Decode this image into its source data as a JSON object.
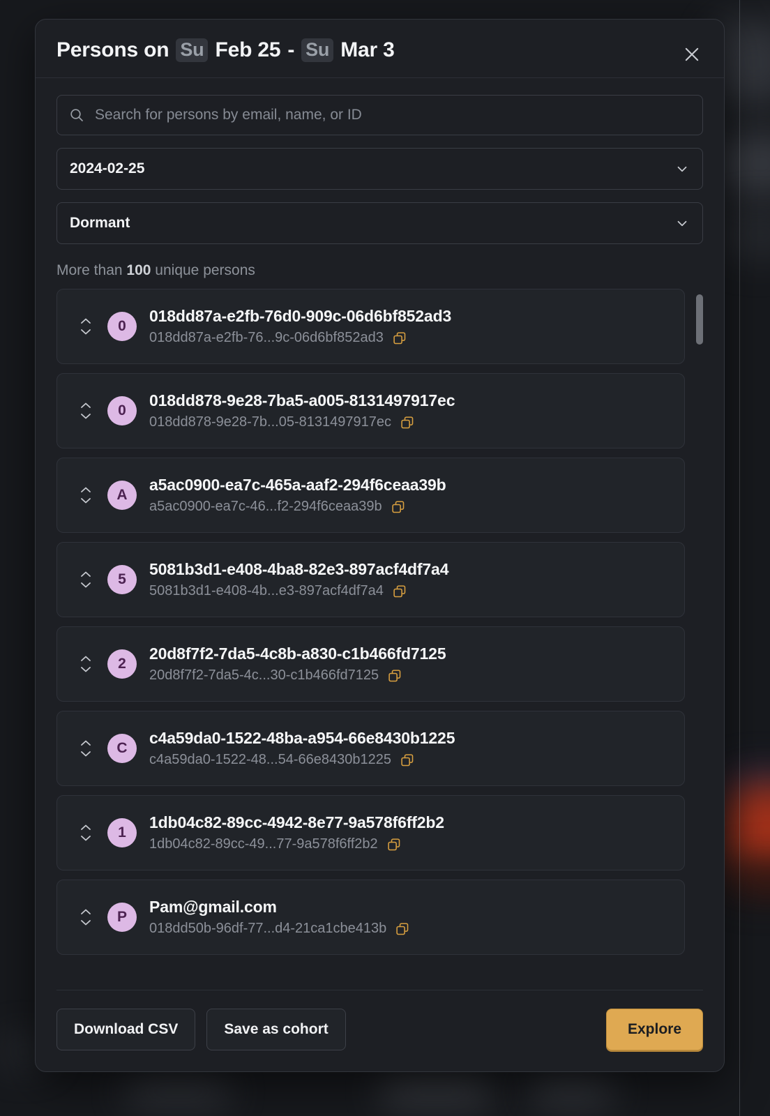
{
  "header": {
    "title_prefix": "Persons on",
    "start_day_badge": "Su",
    "start_date": "Feb 25",
    "separator": "-",
    "end_day_badge": "Su",
    "end_date": "Mar 3",
    "close_icon": "close-icon"
  },
  "search": {
    "placeholder": "Search for persons by email, name, or ID",
    "value": "",
    "icon": "search-icon"
  },
  "filters": {
    "date_select": {
      "value": "2024-02-25",
      "icon": "chevron-down-icon"
    },
    "status_select": {
      "value": "Dormant",
      "icon": "chevron-down-icon"
    }
  },
  "count": {
    "prefix": "More than",
    "number": "100",
    "suffix": "unique persons"
  },
  "persons": [
    {
      "avatar_initial": "0",
      "name": "018dd87a-e2fb-76d0-909c-06d6bf852ad3",
      "id_truncated": "018dd87a-e2fb-76...9c-06d6bf852ad3"
    },
    {
      "avatar_initial": "0",
      "name": "018dd878-9e28-7ba5-a005-8131497917ec",
      "id_truncated": "018dd878-9e28-7b...05-8131497917ec"
    },
    {
      "avatar_initial": "A",
      "name": "a5ac0900-ea7c-465a-aaf2-294f6ceaa39b",
      "id_truncated": "a5ac0900-ea7c-46...f2-294f6ceaa39b"
    },
    {
      "avatar_initial": "5",
      "name": "5081b3d1-e408-4ba8-82e3-897acf4df7a4",
      "id_truncated": "5081b3d1-e408-4b...e3-897acf4df7a4"
    },
    {
      "avatar_initial": "2",
      "name": "20d8f7f2-7da5-4c8b-a830-c1b466fd7125",
      "id_truncated": "20d8f7f2-7da5-4c...30-c1b466fd7125"
    },
    {
      "avatar_initial": "C",
      "name": "c4a59da0-1522-48ba-a954-66e8430b1225",
      "id_truncated": "c4a59da0-1522-48...54-66e8430b1225"
    },
    {
      "avatar_initial": "1",
      "name": "1db04c82-89cc-4942-8e77-9a578f6ff2b2",
      "id_truncated": "1db04c82-89cc-49...77-9a578f6ff2b2"
    },
    {
      "avatar_initial": "P",
      "name": "Pam@gmail.com",
      "id_truncated": "018dd50b-96df-77...d4-21ca1cbe413b"
    }
  ],
  "footer": {
    "download_csv_label": "Download CSV",
    "save_cohort_label": "Save as cohort",
    "explore_label": "Explore"
  },
  "colors": {
    "modal_background": "#1d1f24",
    "row_background": "#212429",
    "accent_gold": "#dfa952",
    "copy_icon_gold": "#d9a040",
    "avatar_background": "#ddb9e5",
    "avatar_text": "#4d2352",
    "muted_text": "#8c9099"
  }
}
